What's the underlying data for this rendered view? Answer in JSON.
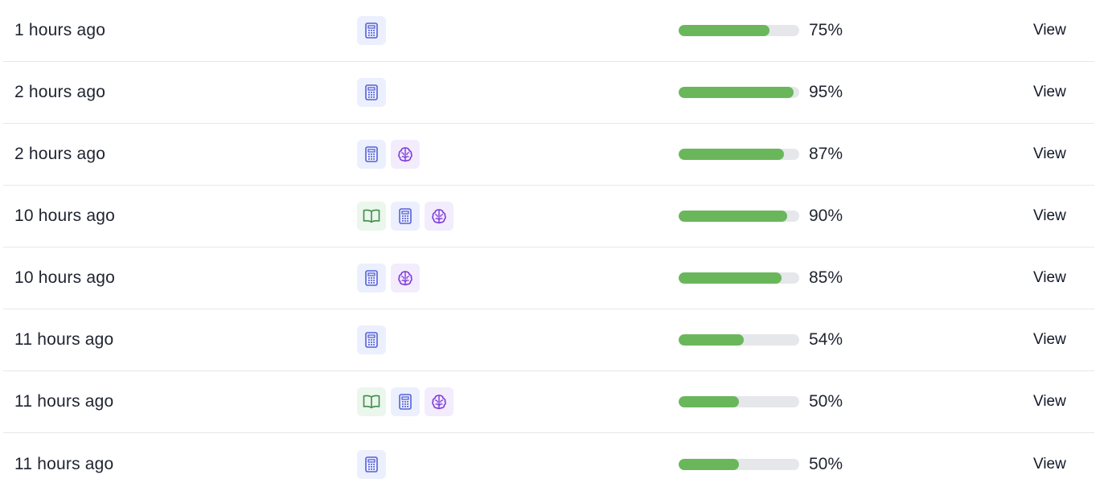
{
  "colors": {
    "progress_fill": "#6ab75b",
    "progress_track": "#e5e7eb",
    "calculator_icon": "#5561d6",
    "brain_icon": "#7c3bd9",
    "book_icon": "#3e8e4a"
  },
  "rows": [
    {
      "time": "1 hours ago",
      "icons": [
        "calculator-icon"
      ],
      "score": 75,
      "score_label": "75%",
      "action": "View"
    },
    {
      "time": "2 hours ago",
      "icons": [
        "calculator-icon"
      ],
      "score": 95,
      "score_label": "95%",
      "action": "View"
    },
    {
      "time": "2 hours ago",
      "icons": [
        "calculator-icon",
        "brain-icon"
      ],
      "score": 87,
      "score_label": "87%",
      "action": "View"
    },
    {
      "time": "10 hours ago",
      "icons": [
        "book-icon",
        "calculator-icon",
        "brain-icon"
      ],
      "score": 90,
      "score_label": "90%",
      "action": "View"
    },
    {
      "time": "10 hours ago",
      "icons": [
        "calculator-icon",
        "brain-icon"
      ],
      "score": 85,
      "score_label": "85%",
      "action": "View"
    },
    {
      "time": "11 hours ago",
      "icons": [
        "calculator-icon"
      ],
      "score": 54,
      "score_label": "54%",
      "action": "View"
    },
    {
      "time": "11 hours ago",
      "icons": [
        "book-icon",
        "calculator-icon",
        "brain-icon"
      ],
      "score": 50,
      "score_label": "50%",
      "action": "View"
    },
    {
      "time": "11 hours ago",
      "icons": [
        "calculator-icon"
      ],
      "score": 50,
      "score_label": "50%",
      "action": "View"
    }
  ]
}
